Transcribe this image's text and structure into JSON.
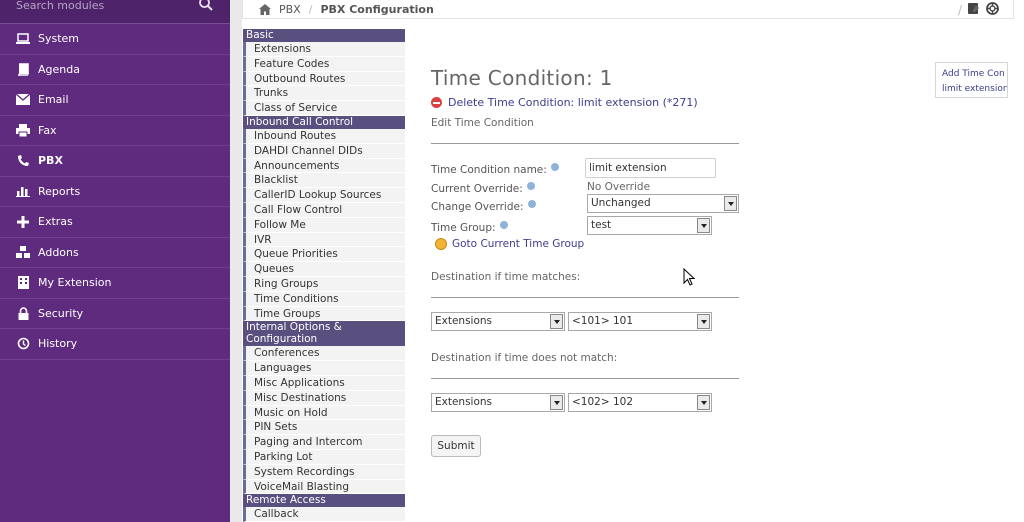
{
  "sidebar": {
    "search_placeholder": "Search modules",
    "items": [
      {
        "label": "System",
        "icon": "laptop-icon"
      },
      {
        "label": "Agenda",
        "icon": "book-icon"
      },
      {
        "label": "Email",
        "icon": "envelope-icon"
      },
      {
        "label": "Fax",
        "icon": "printer-icon"
      },
      {
        "label": "PBX",
        "icon": "phone-icon"
      },
      {
        "label": "Reports",
        "icon": "bar-chart-icon"
      },
      {
        "label": "Extras",
        "icon": "plus-icon"
      },
      {
        "label": "Addons",
        "icon": "cubes-icon"
      },
      {
        "label": "My Extension",
        "icon": "building-icon"
      },
      {
        "label": "Security",
        "icon": "lock-icon"
      },
      {
        "label": "History",
        "icon": "history-icon"
      }
    ]
  },
  "breadcrumb": {
    "home_label": "PBX",
    "current_label": "PBX Configuration",
    "separator": "/"
  },
  "module_menu": {
    "basic": {
      "label": "Basic",
      "items": [
        "Extensions",
        "Feature Codes",
        "Outbound Routes",
        "Trunks",
        "Class of Service"
      ]
    },
    "inbound": {
      "label": "Inbound Call Control",
      "items": [
        "Inbound Routes",
        "DAHDI Channel DIDs",
        "Announcements",
        "Blacklist",
        "CallerID Lookup Sources",
        "Call Flow Control",
        "Follow Me",
        "IVR",
        "Queue Priorities",
        "Queues",
        "Ring Groups",
        "Time Conditions",
        "Time Groups"
      ]
    },
    "internal": {
      "label": "Internal Options & Configuration",
      "items": [
        "Conferences",
        "Languages",
        "Misc Applications",
        "Misc Destinations",
        "Music on Hold",
        "PIN Sets",
        "Paging and Intercom",
        "Parking Lot",
        "System Recordings",
        "VoiceMail Blasting"
      ]
    },
    "remote": {
      "label": "Remote Access",
      "items": [
        "Callback"
      ]
    }
  },
  "form": {
    "title": "Time Condition: 1",
    "delete_link": "Delete Time Condition: limit extension (*271)",
    "section_label": "Edit Time Condition",
    "name_label": "Time Condition name:",
    "name_value": "limit extension",
    "current_override_label": "Current Override:",
    "current_override_value": "No Override",
    "change_override_label": "Change Override:",
    "change_override_value": "Unchanged",
    "time_group_label": "Time Group:",
    "time_group_value": "test",
    "goto_link": "Goto Current Time Group",
    "dest_match_label": "Destination if time matches:",
    "dest_match_type": "Extensions",
    "dest_match_value": "<101> 101",
    "dest_nomatch_label": "Destination if time does not match:",
    "dest_nomatch_type": "Extensions",
    "dest_nomatch_value": "<102> 102",
    "submit_label": "Submit"
  },
  "right_panel": {
    "add_link": "Add Time Con",
    "item": "limit extension"
  }
}
